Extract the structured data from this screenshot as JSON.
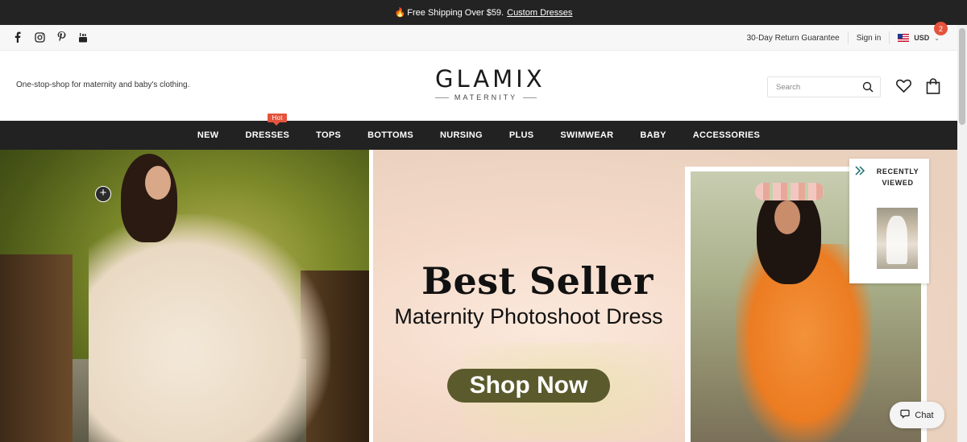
{
  "announcement": {
    "text": "Free Shipping Over $59.",
    "link": "Custom Dresses",
    "icon": "flame-icon"
  },
  "social": [
    {
      "name": "facebook-icon",
      "glyph": "f"
    },
    {
      "name": "instagram-icon",
      "glyph": ""
    },
    {
      "name": "pinterest-icon",
      "glyph": "P"
    },
    {
      "name": "youtube-icon",
      "glyph": ""
    }
  ],
  "utility": {
    "return_guarantee": "30-Day Return Guarantee",
    "sign_in": "Sign in",
    "currency": "USD"
  },
  "header": {
    "tagline": "One-stop-shop for maternity and baby's clothing.",
    "logo_main": "GLAMIX",
    "logo_sub": "MATERNITY",
    "search_placeholder": "Search",
    "cart_count": "2"
  },
  "nav": {
    "items": [
      "NEW",
      "DRESSES",
      "TOPS",
      "BOTTOMS",
      "NURSING",
      "PLUS",
      "SWIMWEAR",
      "BABY",
      "ACCESSORIES"
    ],
    "hot_badge": "Hot"
  },
  "hero": {
    "title": "Best Seller",
    "subtitle": "Maternity Photoshoot Dress",
    "cta": "Shop Now",
    "cta_color": "#5b5a2c"
  },
  "recently_viewed": {
    "label_line1": "RECENTLY",
    "label_line2": "VIEWED"
  },
  "chat": {
    "label": "Chat"
  },
  "colors": {
    "announcement_bg": "#232323",
    "nav_bg": "#222222",
    "badge": "#e5533d",
    "accent_teal": "#1a6b6b"
  }
}
